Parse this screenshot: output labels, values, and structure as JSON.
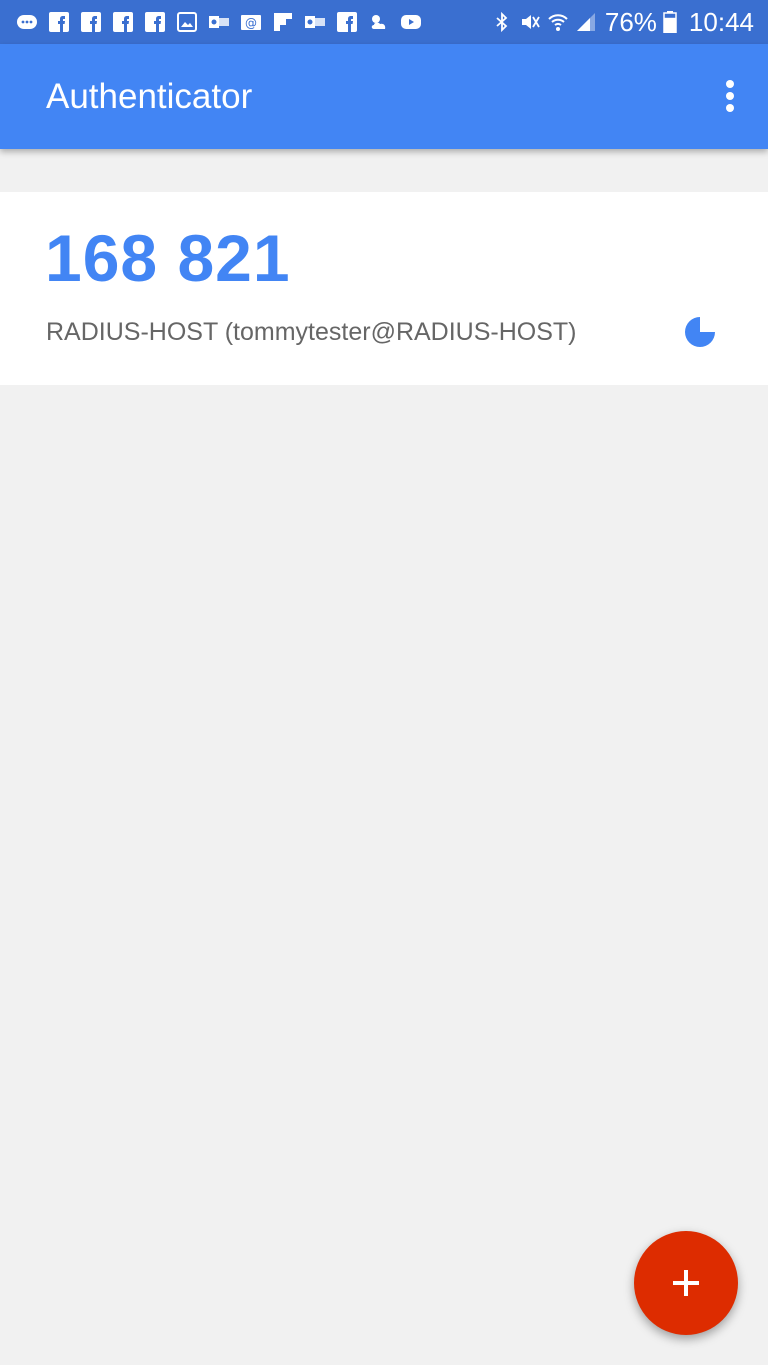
{
  "status_bar": {
    "notification_icons": [
      "messenger-icon",
      "facebook-icon",
      "facebook-icon",
      "facebook-icon",
      "facebook-icon",
      "image-icon",
      "outlook-icon",
      "email-icon",
      "flipboard-icon",
      "outlook-icon",
      "facebook-icon",
      "weather-icon",
      "youtube-icon"
    ],
    "system_icons": [
      "bluetooth-icon",
      "mute-icon",
      "wifi-icon",
      "signal-icon"
    ],
    "battery_percent": "76%",
    "battery_level": 76,
    "time": "10:44"
  },
  "app_bar": {
    "title": "Authenticator",
    "menu_icon": "more-vert-icon"
  },
  "accounts": [
    {
      "code": "168 821",
      "label": "RADIUS-HOST (tommytester@RADIUS-HOST)",
      "timer_icon": "countdown-pie-icon",
      "time_remaining_fraction": 0.75
    }
  ],
  "fab": {
    "icon": "add-icon"
  },
  "colors": {
    "status_bar": "#3a6fd0",
    "app_bar": "#4285f4",
    "code": "#4285f4",
    "fab": "#dd2c00",
    "background": "#f1f1f1"
  }
}
